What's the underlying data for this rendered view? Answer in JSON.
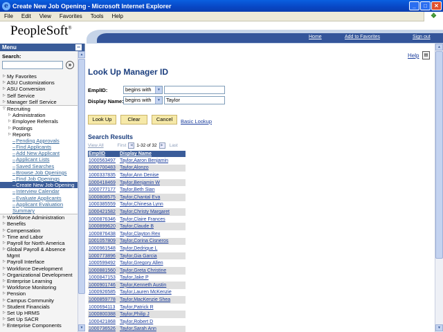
{
  "window": {
    "title": "Create New Job Opening - Microsoft Internet Explorer",
    "minimize": "_",
    "maximize": "□",
    "close": "✕"
  },
  "menubar": {
    "items": [
      "File",
      "Edit",
      "View",
      "Favorites",
      "Tools",
      "Help"
    ]
  },
  "header": {
    "logo": "PeopleSoft",
    "logo_mark": "®",
    "links": {
      "home": "Home",
      "favorites": "Add to Favorites",
      "signout": "Sign out"
    }
  },
  "menu": {
    "title": "Menu",
    "collapse": "−",
    "search_label": "Search:",
    "search_go": "»",
    "items_top": [
      "My Favorites",
      "ASU Customizations",
      "ASU Conversion",
      "Self Service",
      "Manager Self Service"
    ],
    "recruiting": {
      "label": "Recruiting",
      "submenus": [
        "Administration",
        "Employee Referrals",
        "Postings",
        "Reports"
      ],
      "links": [
        "Pending Approvals",
        "Find Applicants",
        "Add New Applicant",
        "Applicant Lists",
        "Saved Searches",
        "Browse Job Openings",
        "Find Job Openings"
      ],
      "selected": "Create New Job Opening",
      "links_after": [
        "Interview Calendar",
        "Evaluate Applicants",
        "Applicant Evaluation"
      ],
      "continuation": "Summary"
    },
    "items_bottom": [
      "Workforce Administration",
      "Benefits",
      "Compensation",
      "Time and Labor",
      "Payroll for North America",
      "Global Payroll & Absence",
      "Payroll Interface",
      "Workforce Development",
      "Organizational Development",
      "Enterprise Learning",
      "Workforce Monitoring",
      "Pension",
      "Campus Community",
      "Student Financials",
      "Set Up HRMS",
      "Set Up SACR",
      "Enterprise Components"
    ],
    "global_payroll_cont": "Mgmt"
  },
  "main": {
    "help": "Help",
    "title": "Look Up Manager ID",
    "emplid_label": "EmplID:",
    "emplid_operator": "begins with",
    "emplid_value": "",
    "name_label": "Display Name:",
    "name_operator": "begins with",
    "name_value": "Taylor",
    "buttons": {
      "lookup": "Look Up",
      "clear": "Clear",
      "cancel": "Cancel"
    },
    "basic_lookup": "Basic Lookup",
    "results_title": "Search Results",
    "nav": {
      "view_all": "View All",
      "first": "First",
      "count": "1-32 of 32",
      "last": "Last"
    },
    "columns": [
      "EmplID",
      "Display Name"
    ],
    "rows": [
      [
        "1000563497",
        "Taylor,Aaron Benjamin"
      ],
      [
        "1000700483",
        "Taylor,Alonzo"
      ],
      [
        "1000337835",
        "Taylor,Ann Denise"
      ],
      [
        "1000418469",
        "Taylor,Benjamin W"
      ],
      [
        "1000777177",
        "Taylor,Beth Sian"
      ],
      [
        "1000808575",
        "Taylor,Chantal Eva"
      ],
      [
        "1000385559",
        "Taylor,Chinesa Lynn"
      ],
      [
        "1000421582",
        "Taylor,Christy Margaret"
      ],
      [
        "1000876346",
        "Taylor,Claire Frances"
      ],
      [
        "1000899620",
        "Taylor,Claude B"
      ],
      [
        "1000876438",
        "Taylor,Clayton Rex"
      ],
      [
        "1001057809",
        "Taylor,Corina Cisneros"
      ],
      [
        "1000961548",
        "Taylor,Dedrique L"
      ],
      [
        "1000773896",
        "Taylor,Gia Garcia"
      ],
      [
        "1000599492",
        "Taylor,Gregory Allen"
      ],
      [
        "1000881560",
        "Taylor,Greta Christine"
      ],
      [
        "1000847153",
        "Taylor,Jake P"
      ],
      [
        "1000901746",
        "Taylor,Kenneth Austin"
      ],
      [
        "1000926585",
        "Taylor,Lauren McKenzie"
      ],
      [
        "1000859778",
        "Taylor,MacKenzie Shea"
      ],
      [
        "1000694113",
        "Taylor,Patrick R"
      ],
      [
        "1000800388",
        "Taylor,Philip J"
      ],
      [
        "1000421868",
        "Taylor,Robert D"
      ],
      [
        "1000736526",
        "Taylor,Sarah Ann"
      ]
    ]
  }
}
